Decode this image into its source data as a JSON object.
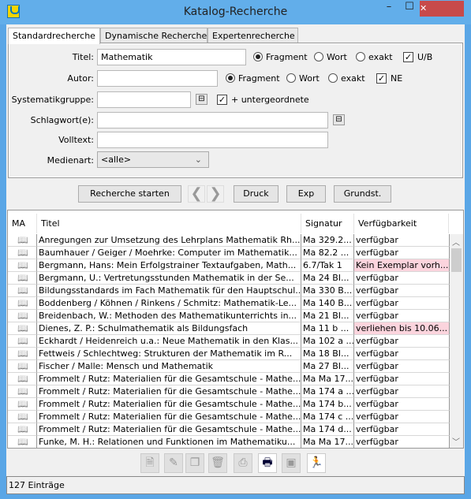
{
  "window": {
    "title": "Katalog-Recherche",
    "minimize": "–",
    "maximize": "☐",
    "close": "✕"
  },
  "tabs": [
    {
      "label": "Standardrecherche",
      "active": true
    },
    {
      "label": "Dynamische Recherche"
    },
    {
      "label": "Expertenrecherche"
    }
  ],
  "form": {
    "titel": {
      "label": "Titel:",
      "value": "Mathematik",
      "mode": "Fragment",
      "opt1": "Fragment",
      "opt2": "Wort",
      "opt3": "exakt",
      "check_label": "U/B",
      "checked": true
    },
    "autor": {
      "label": "Autor:",
      "value": "",
      "mode": "Fragment",
      "opt1": "Fragment",
      "opt2": "Wort",
      "opt3": "exakt",
      "check_label": "NE",
      "checked": true
    },
    "systematik": {
      "label": "Systematikgruppe:",
      "value": "",
      "check_label": "+ untergeordnete",
      "checked": true
    },
    "schlagwort": {
      "label": "Schlagwort(e):",
      "value": ""
    },
    "volltext": {
      "label": "Volltext:",
      "value": ""
    },
    "medienart": {
      "label": "Medienart:",
      "value": "<alle>"
    }
  },
  "buttons": {
    "search": "Recherche starten",
    "prev": "❮",
    "next": "❯",
    "print": "Druck",
    "export": "Exp",
    "reset": "Grundst."
  },
  "table": {
    "columns": [
      "MA",
      "Titel",
      "Signatur",
      "Verfügbarkeit"
    ],
    "highlight_color": "#fbd4dd",
    "rows": [
      {
        "title": "Anregungen zur Umsetzung des Lehrplans Mathematik Rh...",
        "sig": "Ma 329.2...",
        "avail": "verfügbar"
      },
      {
        "title": "Baumhauer / Geiger / Moehrke: Computer im Mathematik...",
        "sig": "Ma 82.2 ...",
        "avail": "verfügbar"
      },
      {
        "title": "Bergmann, Hans: Mein Erfolgstrainer Textaufgaben, Math...",
        "sig": "6.7/Tak 1",
        "avail": "Kein Exemplar vorh...",
        "highlight": true
      },
      {
        "title": "Bergmann, U.: Vertretungsstunden Mathematik in der Se...",
        "sig": "Ma 24 BI...",
        "avail": "verfügbar"
      },
      {
        "title": "Bildungsstandards im Fach Mathematik für den Hauptschul...",
        "sig": "Ma 330 B...",
        "avail": "verfügbar"
      },
      {
        "title": "Boddenberg / Köhnen / Rinkens / Schmitz: Mathematik-Le...",
        "sig": "Ma 140 B...",
        "avail": "verfügbar"
      },
      {
        "title": "Breidenbach, W.: Methoden des Mathematikunterrichts in...",
        "sig": "Ma 21 BI...",
        "avail": "verfügbar"
      },
      {
        "title": "Dienes, Z. P.: Schulmathematik als Bildungsfach",
        "sig": "Ma 11 b ...",
        "avail": "verliehen bis 10.06...",
        "highlight": true
      },
      {
        "title": "Eckhardt / Heidenreich u.a.: Neue Mathematik in den Klas...",
        "sig": "Ma 102 a ...",
        "avail": "verfügbar"
      },
      {
        "title": "Fettweis / Schlechtweg: Strukturen der Mathematik im R...",
        "sig": "Ma 18 BI...",
        "avail": "verfügbar"
      },
      {
        "title": "Fischer / Malle: Mensch und Mathematik",
        "sig": "Ma 27 BI...",
        "avail": "verfügbar"
      },
      {
        "title": "Frommelt / Rutz: Materialien für die Gesamtschule - Mathe...",
        "sig": "Ma Ma 17...",
        "avail": "verfügbar"
      },
      {
        "title": "Frommelt / Rutz: Materialien für die Gesamtschule - Mathe...",
        "sig": "Ma 174 a ...",
        "avail": "verfügbar"
      },
      {
        "title": "Frommelt / Rutz: Materialien für die Gesamtschule - Mathe...",
        "sig": "Ma 174 b...",
        "avail": "verfügbar"
      },
      {
        "title": "Frommelt / Rutz: Materialien für die Gesamtschule - Mathe...",
        "sig": "Ma 174 c ...",
        "avail": "verfügbar"
      },
      {
        "title": "Frommelt / Rutz: Materialien für die Gesamtschule - Mathe...",
        "sig": "Ma 174 d...",
        "avail": "verfügbar"
      },
      {
        "title": "Funke, M. H.: Relationen und Funktionen im Mathematiku...",
        "sig": "Ma Ma 17...",
        "avail": "verfügbar"
      }
    ]
  },
  "toolbar": [
    {
      "icon": "new-document-icon",
      "glyph": "🗎"
    },
    {
      "icon": "edit-document-icon",
      "glyph": "✎"
    },
    {
      "icon": "copy-icon",
      "glyph": "❐"
    },
    {
      "icon": "delete-icon",
      "glyph": "🗑"
    },
    {
      "icon": "print-icon",
      "glyph": "⎙"
    },
    {
      "icon": "print-preview-icon",
      "glyph": "🖶"
    },
    {
      "icon": "select-icon",
      "glyph": "▣"
    },
    {
      "icon": "exit-icon",
      "glyph": "🏃"
    }
  ],
  "status": "127 Einträge"
}
